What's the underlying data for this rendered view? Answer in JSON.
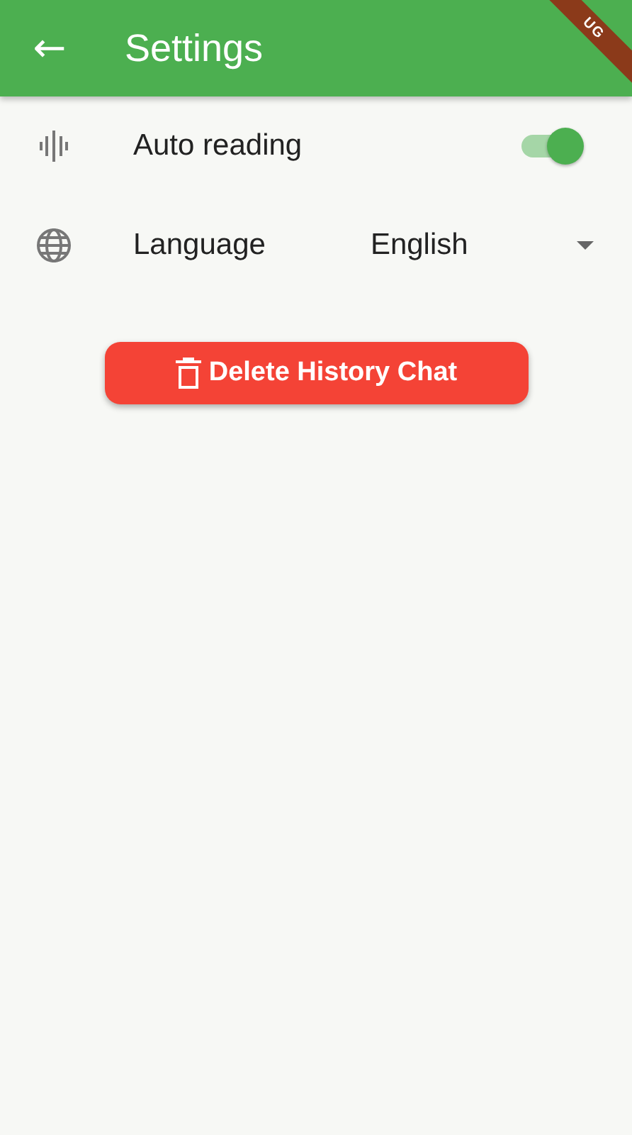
{
  "app_bar": {
    "back": "←",
    "title": "Settings"
  },
  "debug_banner": "UG",
  "settings": [
    {
      "kind": "toggle",
      "label": "Auto reading",
      "on": true
    },
    {
      "kind": "dropdown",
      "label": "Language",
      "value": "English"
    }
  ],
  "delete_button": {
    "label": "Delete History Chat"
  }
}
